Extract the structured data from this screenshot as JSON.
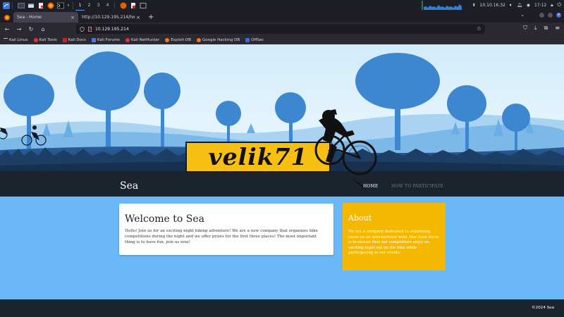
{
  "colors": {
    "accent_blue": "#3f6fe0",
    "content_blue": "#6ab8f7",
    "about_yellow": "#f5b800",
    "header_dark": "#1b232c",
    "logo_yellow": "#f6bf11"
  },
  "taskbar": {
    "workspaces": [
      "1",
      "2",
      "3",
      "4"
    ],
    "active_workspace": "1",
    "network_text": "10.10.16.32",
    "clock": "17:12"
  },
  "browser": {
    "tabs": [
      {
        "label": "Sea - Home",
        "active": true
      },
      {
        "label": "http://10.129.195.214/how-t",
        "active": false
      }
    ],
    "url": "10.129.195.214",
    "bookmarks": [
      "Kali Linux",
      "Kali Tools",
      "Kali Docs",
      "Kali Forums",
      "Kali NetHunter",
      "Exploit-DB",
      "Google Hacking DB",
      "OffSec"
    ]
  },
  "site": {
    "logo_text": "velik71",
    "title": "Sea",
    "nav": {
      "home": "HOME",
      "participate": "HOW TO PARTICIPATE"
    },
    "welcome": {
      "title": "Welcome to Sea",
      "text": "Hello! Join us for an exciting night biking adventure! We are a new company that organizes bike competitions during the night and we offer prizes for the first three places! The most important thing is to have fun, join us now!"
    },
    "about": {
      "title": "About",
      "text": "We are a company dedicated to organizing races on an international level. Our main focus is to ensure that our competitors enjoy an exciting night out on the bike while participating in our events."
    },
    "footer": "©2024 Sea"
  }
}
